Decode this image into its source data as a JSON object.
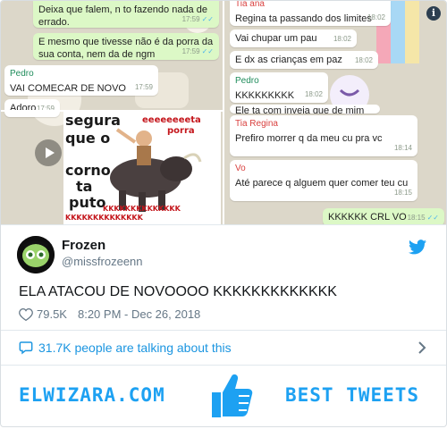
{
  "chat_left": {
    "msg1": {
      "text": "Deixa que falem, n to fazendo nada de errado.",
      "time": "17:59"
    },
    "msg2": {
      "text": "E mesmo que tivesse não é da porra da sua conta, nem da de ngm",
      "time": "17:59"
    },
    "msg3": {
      "sender": "Pedro",
      "text": "VAI COMECAR DE NOVO",
      "time": "17:59"
    },
    "msg4": {
      "text": "Adoro",
      "time": "17:59"
    }
  },
  "meme": {
    "line1": "segura",
    "line2": "que o",
    "line3": "corno",
    "line4": "ta",
    "line5": "puto",
    "small1": "eeeeeeeeta",
    "small2": "porra",
    "red1": "KKKKKKKKKKKKKK",
    "red2": "KKKKKKKKKKKKKK"
  },
  "chat_right": {
    "top_sender": "Tia ana",
    "msg1": {
      "text": "Regina ta passando dos limites",
      "time": "18:02"
    },
    "msg2": {
      "text": "Vai chupar um pau",
      "time": "18:02"
    },
    "msg3": {
      "text": "E dx as crianças em paz",
      "time": "18:02"
    },
    "msg4": {
      "sender": "Pedro",
      "text": "KKKKKKKKK",
      "time": "18:02"
    },
    "msg4b": {
      "text": "Ele ta com inveja que de mim"
    },
    "msg5": {
      "sender": "Tia Regina",
      "text": "Prefiro morrer q da meu cu pra vc",
      "time": "18:14"
    },
    "msg6": {
      "sender": "Vo",
      "text": "Até parece q alguem quer comer teu cu",
      "time": "18:15"
    },
    "msg7": {
      "text": "KKKKKK CRL VO",
      "time": "18:15"
    }
  },
  "tweet": {
    "name": "Frozen",
    "handle": "@missfrozeenn",
    "text": "ELA ATACOU DE NOVOOOO KKKKKKKKKKKKK",
    "likes": "79.5K",
    "time": "8:20 PM - Dec 26, 2018",
    "talking": "31.7K people are talking about this"
  },
  "footer": {
    "left": "ELWIZARA.COM",
    "right": "BEST TWEETS"
  },
  "colors": {
    "twitter_blue": "#1da1f2",
    "whatsapp_out": "#dcf8c6",
    "meme_red": "#c4161c"
  }
}
